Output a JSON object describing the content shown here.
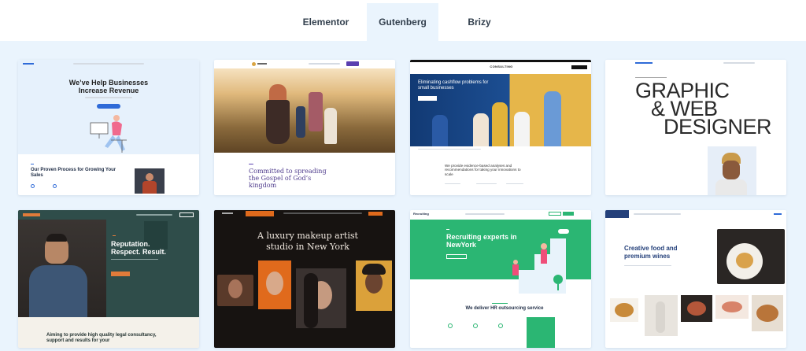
{
  "tabs": [
    {
      "label": "Elementor",
      "active": false
    },
    {
      "label": "Gutenberg",
      "active": true
    },
    {
      "label": "Brizy",
      "active": false
    }
  ],
  "colors": {
    "page_bg": "#eaf4fd",
    "tab_text": "#33404e",
    "blue_accent": "#2f6bd8",
    "green_brand": "#2bb673",
    "law_teal": "#2f4d4a",
    "law_orange": "#e07b3a",
    "church_purple": "#4e3b8c",
    "makeup_orange": "#e06a1c"
  },
  "cards": {
    "business": {
      "headline": "We’ve Help Businesses Increase Revenue",
      "section_title": "Our Proven Process for Growing Your Sales"
    },
    "church": {
      "tagline": "Committed to spreading the Gospel of God’s kingdom"
    },
    "consulting": {
      "brand": "CONSULTING",
      "hero_title": "Eliminating cashflow problems for small businesses",
      "body": "We provide evidence-based analyses and recommendations for taking your innovations to scale"
    },
    "designer": {
      "line1": "GRAPHIC",
      "line2": "& WEB",
      "line3": "DESIGNER"
    },
    "law": {
      "headline": "Reputation. Respect. Result.",
      "footer": "Aiming to provide high quality legal consultancy, support and results for your"
    },
    "makeup": {
      "headline": "A luxury makeup artist studio in New York"
    },
    "recruiting": {
      "brand": "Recruiting",
      "hero": "Recruiting experts in NewYork",
      "section": "We deliver HR outsourcing service"
    },
    "food": {
      "headline": "Creative food and premium wines"
    }
  }
}
